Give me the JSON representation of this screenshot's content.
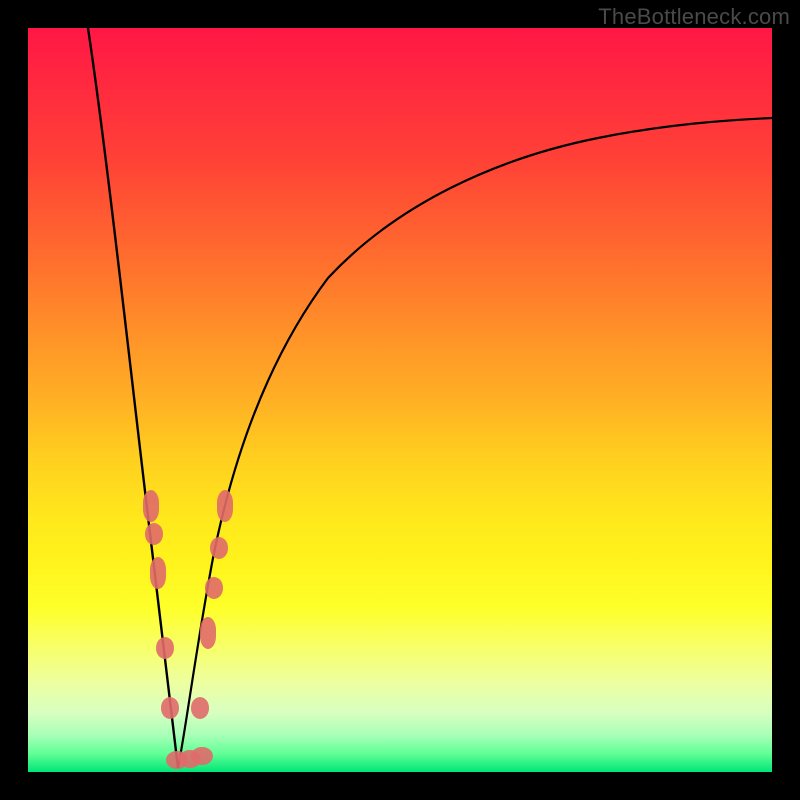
{
  "watermark": "TheBottleneck.com",
  "colors": {
    "frame": "#000000",
    "curve": "#000000",
    "dot": "#e06a6a",
    "grad_top": "#ff1744",
    "grad_bottom": "#00e676"
  },
  "chart_data": {
    "type": "line",
    "title": "",
    "xlabel": "",
    "ylabel": "",
    "xlim": [
      0,
      100
    ],
    "ylim": [
      0,
      100
    ],
    "note": "V-shaped bottleneck curve; minimum ≈ x=20 where y≈0. Left branch falls steeply from (≈8,100) to (20,0); right branch rises with diminishing slope to (100, ≈85).",
    "x": [
      8,
      10,
      12,
      14,
      16,
      18,
      19,
      20,
      21,
      22,
      24,
      26,
      28,
      30,
      34,
      38,
      42,
      46,
      50,
      55,
      60,
      65,
      70,
      75,
      80,
      85,
      90,
      95,
      100
    ],
    "y": [
      100,
      80,
      62,
      46,
      32,
      16,
      6,
      0,
      4,
      10,
      22,
      31,
      38,
      44,
      52,
      58,
      63,
      66,
      69,
      72,
      74.5,
      76.5,
      78,
      79.5,
      81,
      82,
      83,
      84,
      85
    ],
    "markers_note": "Salmon bead cluster near the trough on both branches",
    "markers": [
      {
        "x": 16.5,
        "y": 36
      },
      {
        "x": 17,
        "y": 30
      },
      {
        "x": 17.5,
        "y": 24
      },
      {
        "x": 18.5,
        "y": 14
      },
      {
        "x": 19,
        "y": 7
      },
      {
        "x": 20,
        "y": 1
      },
      {
        "x": 21,
        "y": 1.5
      },
      {
        "x": 22,
        "y": 2
      },
      {
        "x": 22.5,
        "y": 8
      },
      {
        "x": 24,
        "y": 18
      },
      {
        "x": 25,
        "y": 24
      },
      {
        "x": 25.5,
        "y": 30
      },
      {
        "x": 26.5,
        "y": 36
      }
    ]
  }
}
